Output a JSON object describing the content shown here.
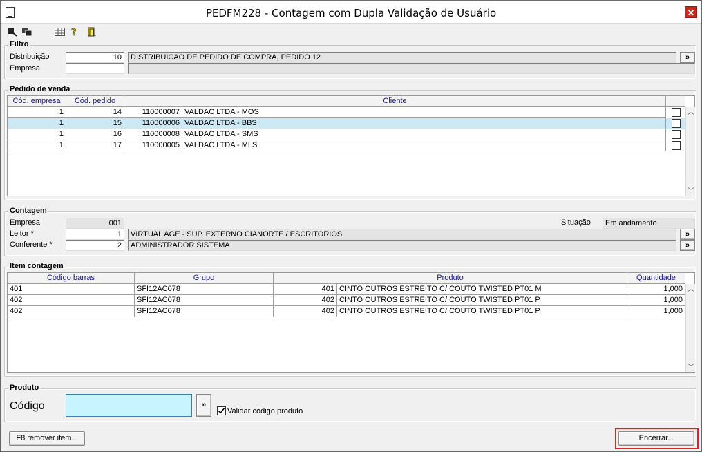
{
  "window": {
    "title": "PEDFM228 - Contagem com Dupla Validação de Usuário",
    "close_glyph": "✕"
  },
  "toolbar": {
    "icons": [
      "first-record-icon",
      "copy-icon",
      "grid-icon",
      "help-icon",
      "exit-door-icon"
    ]
  },
  "filtro": {
    "label": "Filtro",
    "distribuicao_label": "Distribuição",
    "distribuicao_value": "10",
    "distribuicao_desc": "DISTRIBUICAO DE PEDIDO DE COMPRA, PEDIDO 12",
    "empresa_label": "Empresa",
    "empresa_value": "",
    "empresa_desc": "",
    "lookup_glyph": "»"
  },
  "pedido": {
    "label": "Pedido de venda",
    "columns": [
      "Cód. empresa",
      "Cód. pedido",
      "Cliente",
      ""
    ],
    "rows": [
      {
        "empresa": "1",
        "pedido": "14",
        "cliente_cod": "110000007",
        "cliente_nome": "VALDAC LTDA - MOS",
        "selected": false
      },
      {
        "empresa": "1",
        "pedido": "15",
        "cliente_cod": "110000006",
        "cliente_nome": "VALDAC LTDA - BBS",
        "selected": true
      },
      {
        "empresa": "1",
        "pedido": "16",
        "cliente_cod": "110000008",
        "cliente_nome": "VALDAC LTDA - SMS",
        "selected": false
      },
      {
        "empresa": "1",
        "pedido": "17",
        "cliente_cod": "110000005",
        "cliente_nome": "VALDAC LTDA - MLS",
        "selected": false
      }
    ],
    "selected_color": "#cce8f4"
  },
  "contagem": {
    "label": "Contagem",
    "empresa_label": "Empresa",
    "empresa_value": "001",
    "situacao_label": "Situação",
    "situacao_value": "Em andamento",
    "leitor_label": "Leitor *",
    "leitor_value": "1",
    "leitor_desc": "VIRTUAL AGE - SUP. EXTERNO CIANORTE / ESCRITORIOS",
    "conferente_label": "Conferente *",
    "conferente_value": "2",
    "conferente_desc": "ADMINISTRADOR SISTEMA"
  },
  "itens": {
    "label": "Item contagem",
    "columns": [
      "Código barras",
      "Grupo",
      "Produto",
      "Quantidade"
    ],
    "rows": [
      {
        "codigo": "401",
        "grupo": "SFI12AC078",
        "prod_cod": "401",
        "prod_desc": "CINTO OUTROS ESTREITO C/ COUTO TWISTED PT01 M",
        "quantidade": "1,000"
      },
      {
        "codigo": "402",
        "grupo": "SFI12AC078",
        "prod_cod": "402",
        "prod_desc": "CINTO OUTROS ESTREITO C/ COUTO TWISTED PT01 P",
        "quantidade": "1,000"
      },
      {
        "codigo": "402",
        "grupo": "SFI12AC078",
        "prod_cod": "402",
        "prod_desc": "CINTO OUTROS ESTREITO C/ COUTO TWISTED PT01 P",
        "quantidade": "1,000"
      }
    ]
  },
  "produto": {
    "label": "Produto",
    "codigo_label": "Código",
    "codigo_value": "",
    "input_color": "#c8f4ff",
    "validar_label": "Validar código produto",
    "validar_checked": true
  },
  "footer": {
    "remove_label": "F8 remover item...",
    "encerrar_label": "Encerrar...",
    "highlight_color": "#d6262c"
  }
}
